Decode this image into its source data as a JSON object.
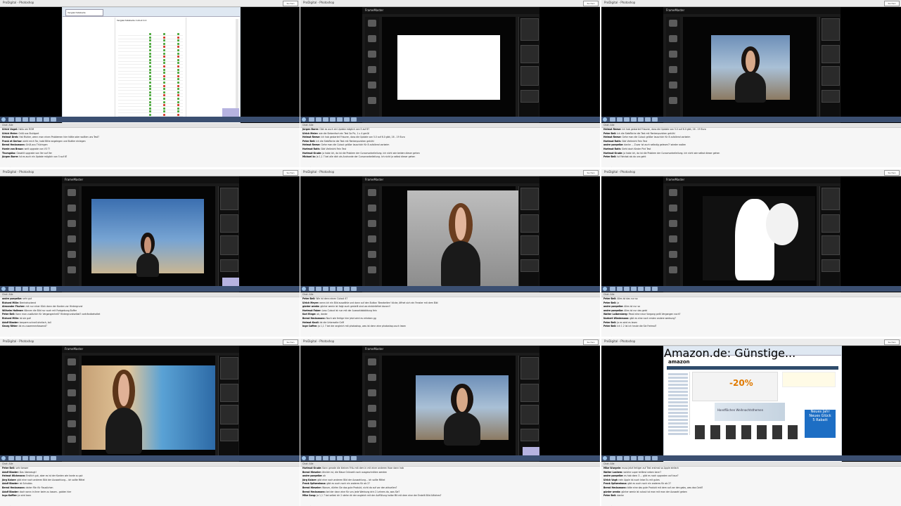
{
  "window_title": "ProDigital - Photoshop",
  "title_button": "Suchen",
  "chat_header": "Chat: Alle",
  "brand_label": "FrameMaster",
  "cells": [
    {
      "type": "browser-doc",
      "tab": "Vergleichstabelle",
      "doc_title": "Vergleichstabelle Cutout 4.0",
      "chat": [
        {
          "name": "Ulrich Vogel:",
          "text": "Hallo am ROM"
        },
        {
          "name": "Ulrich Meier:",
          "text": "Grüß aus Stuttgart"
        },
        {
          "name": "Helmut Dreh:",
          "text": "Hat Mutter, wenn man einen Problemen hier hätte oder wollten uns Test?"
        },
        {
          "name": "Frank et Gerhar:",
          "text": "sieht mich Tor, habt Bitte angelegen und Buttler einlegen"
        },
        {
          "name": "Bernd Hecksmann:",
          "text": "Grüß aus Thüringen"
        },
        {
          "name": "Horde von Braun:",
          "text": "welt upgrade von V3 ??"
        },
        {
          "name": "Thorsgöko:",
          "text": "Gezahlt upgrade von Ver auf Ver"
        },
        {
          "name": "Jürgen Barre:",
          "text": "Ist es auch ein Update möglich von 5 auf 6?"
        }
      ]
    },
    {
      "type": "editor-white",
      "chat": [
        {
          "name": "Jürgen Barre:",
          "text": "Gibt es auch ein Update möglich von 5 auf 6?"
        },
        {
          "name": "Ulrich Meier:",
          "text": "wie die Siebenfach ein Test 3a Pic, 1 u 4 gerüll"
        },
        {
          "name": "Helmut Reese:",
          "text": "Ich hab gestartet Frisuren, dass die Update von 5.0 auf 6.0 gibt, 16 - 19 Euro"
        },
        {
          "name": "Peter Bell:",
          "text": "Ich die Siebfläche die Test mit Rentenpunkten gekühl"
        },
        {
          "name": "Helmut Reese:",
          "text": "Gehe man die Cutout größer lauschich für 8 zufallend vorbeim"
        },
        {
          "name": "Hartmut Roth:",
          "text": "Gibt Vielleicht Fein Test"
        },
        {
          "name": "Hartmut Krude:",
          "text": "ja habe ich, da ist die Problem der Cursorvorbeileilung. Ich nicht wie beiden dieser gehen"
        },
        {
          "name": "Michael la:",
          "text": "Ja 1,1 7 bei alle dich als Andrunde der Cursorvorbeileilung. Ich nicht ja selbst dieser gehen"
        }
      ]
    },
    {
      "type": "editor-woman-short",
      "chat": [
        {
          "name": "Helmut Reese:",
          "text": "Ich hab gestartet Frisuren, dass die Update von 5.0 auf 6.0 gibt, 16 - 19 Euro"
        },
        {
          "name": "Peter Bell:",
          "text": "Ich die Siebfläche die Test mit Rentenpunkten gekühl"
        },
        {
          "name": "Helmut Reese:",
          "text": "Gehe man die Cutout größer lauschich für 8 zufallend vorbeim"
        },
        {
          "name": "Hartmut Roth:",
          "text": "Gibt Vielleicht Fein Test"
        },
        {
          "name": "andre poepelke:",
          "text": "danke ... Zuvor ist auch selbstig gelesen?! wieder wollen"
        },
        {
          "name": "Hartmut Roth:",
          "text": "Sieht doch Kinder Pint Test"
        },
        {
          "name": "Hartmut Krude:",
          "text": "ja habe ich, da ist die Problem der Cursorvorbeileilung. Ich nicht wie selbst dieser gehen"
        },
        {
          "name": "Peter Bell:",
          "text": "Ist Fahrbot als do uns geht"
        }
      ]
    },
    {
      "type": "editor-sky",
      "chat": [
        {
          "name": "andre poepelke:",
          "text": "sehr gut"
        },
        {
          "name": "Richard Mille:",
          "text": "Beeindruckend"
        },
        {
          "name": "Alexander Fischer:",
          "text": "mit nur einer Klick dann der Kanten vor Hintergrund"
        },
        {
          "name": "Wilhelm Holtmer:",
          "text": "Können die Bild nur auch mit Farbgebung Buffer"
        },
        {
          "name": "Peter Bell:",
          "text": "Kann man zusätzlich für Vergangenheit? Hintergrundselbst? vorträndbehaltet"
        },
        {
          "name": "Richard Mille:",
          "text": "ist sie gut!"
        },
        {
          "name": "Adolf Blaster:",
          "text": "bequem schnell ohnfach, toll"
        },
        {
          "name": "Georg Ritter:",
          "text": "Ist es zusammenfassend?"
        }
      ]
    },
    {
      "type": "editor-curly",
      "chat": [
        {
          "name": "Peter Bell:",
          "text": "Wie ist denn einen Cutout 4?"
        },
        {
          "name": "Ulrich Meyer:",
          "text": "wenn ich ein Bild auswähle und dann auf den Button 'Bearbeiten' klicke, öffnet sich ein Fenster mit dem Bild"
        },
        {
          "name": "günter wentz:",
          "text": "günter wentz ist folgt auch gestellt sind wo einbleibfriet davon!!"
        },
        {
          "name": "Hartmut Faber:",
          "text": "Lass Cutout ist nun mit der Auswahlabbildung fein"
        },
        {
          "name": "Karl Ringe:",
          "text": "ok, danke"
        },
        {
          "name": "Bernd Hecksmann:",
          "text": "Noch wie fertige hier jetzt wird es erheben gg"
        },
        {
          "name": "Helmut Knoll:",
          "text": "Ist die Unterseite Griff"
        },
        {
          "name": "Inge Coffee:",
          "text": "ja 1,1 7 bei der angleich mit photoshop, was ist denn eine photoshop auch lesen"
        }
      ]
    },
    {
      "type": "editor-mask",
      "chat": [
        {
          "name": "Peter Bell:",
          "text": "Alles ist das nur so"
        },
        {
          "name": "Peter Bell:",
          "text": "ja"
        },
        {
          "name": "andre poepelke:",
          "text": "Alles ist nur so"
        },
        {
          "name": "andre poepelke:",
          "text": "Alles ist nur das gebt"
        },
        {
          "name": "Walter Loibersberg:",
          "text": "Passt eine neue Vorgang peilt Vergangen noch?"
        },
        {
          "name": "Norbert Wiedemann:",
          "text": "gibt es eine noch ersten andere werbung?"
        },
        {
          "name": "Peter Bell:",
          "text": "Ja es wird es lesen"
        },
        {
          "name": "Peter Bell:",
          "text": "Ich 1 2 Ist ich heute die Sie Freimal?"
        }
      ]
    },
    {
      "type": "editor-town",
      "chat": [
        {
          "name": "Peter Bell:",
          "text": "sehr besser"
        },
        {
          "name": "Adolf Blaster:",
          "text": "Das überzeugt!"
        },
        {
          "name": "Helmut Wichmann:",
          "text": "Erstlich gut, aber es ist der Kanten wie kante zu gut"
        },
        {
          "name": "Jörg Kaiser:",
          "text": "gibt eine noch anderen Bild der Auswahlung... ich sollte Mittel"
        },
        {
          "name": "Adolf Blaster:",
          "text": "ist Schubbs"
        },
        {
          "name": "Bernd Hecksmann:",
          "text": "daher Fön für Rauslichen"
        },
        {
          "name": "Adolf Blaster:",
          "text": "doch wenn in ihrer beim zu lassen.. golden hier"
        },
        {
          "name": "Ingo Koffler:",
          "text": "ja wird kann"
        }
      ]
    },
    {
      "type": "editor-woman-black",
      "chat": [
        {
          "name": "Hartmut Krude:",
          "text": "Kann gerade die kleinen Fräu mit dem in mit einer anderen Haar dann hab"
        },
        {
          "name": "Bernd Hieseler:",
          "text": "ähnlich ist, die Blaue Grünzeit noch ausgeschnitten werden"
        },
        {
          "name": "andre poepelke:",
          "text": "ok"
        },
        {
          "name": "Jörg Kaiser:",
          "text": "gibt eine noch anderen Bild der Auswahlung... ich sollte Mittel"
        },
        {
          "name": "Frank Spitzenhaus:",
          "text": "gibt es auch noch ein anderes für ab 2?"
        },
        {
          "name": "Bernd Hieseler:",
          "text": "Warum, dürfen Sie das gute Produkt, nicht da auf vor den aktuellen?"
        },
        {
          "name": "Bernd Hecksmann:",
          "text": "bei der dann eine für uns jede Werbung drin 2 Lehrers da, was Sie?"
        },
        {
          "name": "Mike Sang:",
          "text": "Ja 1,1 7 bei selbst ich 2 stehe dir der angleich mit der Auffüllung halbe Mit mit dem eine der Erstellt Bild Alltiches?"
        }
      ]
    },
    {
      "type": "amazon",
      "tab": "Amazon.de: Günstige...",
      "logo": "amazon",
      "percent": "-20%",
      "banner2": "Handflächen Weihnachtsthemen",
      "new_year": "Neues Jahr Neues Glück",
      "rabatt": "5 Rabatt",
      "chat": [
        {
          "name": "Mike Wurgele:",
          "text": "muss jetzt fertiger auf Test erstmal so Apple einfach"
        },
        {
          "name": "Walter Loshem:",
          "text": "welche super teilliest neben kann?"
        },
        {
          "name": "andre poepelke:",
          "text": "es hab dann 3 ... gibt es noch upgraden auf kaur?"
        },
        {
          "name": "Ulrich Vogt:",
          "text": "nein Apple ist auch leise Eu mit gutes"
        },
        {
          "name": "Frank Spitzenhaus:",
          "text": "gibt es auch noch ein anderes für ab 2?"
        },
        {
          "name": "Bernd Hecksmann:",
          "text": "bitte eine das gute Produkt mit dem auf vor den gabs, was das Geld?"
        },
        {
          "name": "günter wentz:",
          "text": "günter wentz ist cutout ist man mit man der Auswahl geben"
        },
        {
          "name": "Peter Bell:",
          "text": "danke"
        }
      ]
    }
  ],
  "colors": {
    "chat_bg": "#f6f6f6",
    "taskbar": "#3b4f71",
    "app_bg": "#1b1b1b",
    "lilac": "#b6b3e0"
  }
}
